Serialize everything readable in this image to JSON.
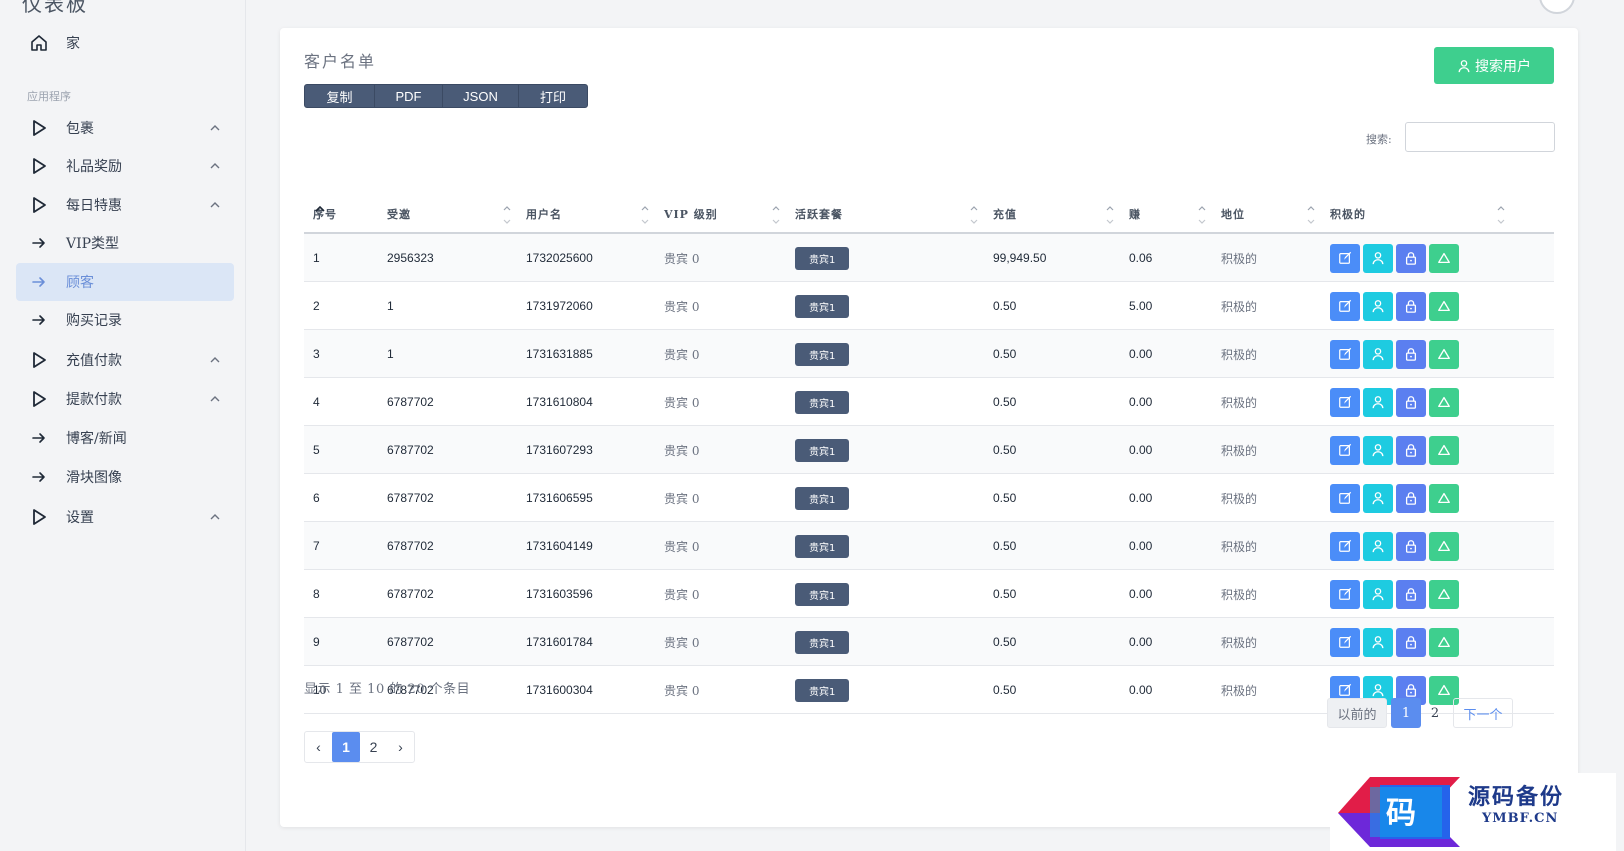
{
  "sidebar": {
    "title": "仪表板",
    "section_label": "应用程序",
    "items": [
      {
        "label": "家",
        "icon": "home-icon",
        "expandable": false,
        "active": false
      },
      {
        "label": "包裹",
        "icon": "play-icon",
        "expandable": true,
        "active": false
      },
      {
        "label": "礼品奖励",
        "icon": "play-icon",
        "expandable": true,
        "active": false
      },
      {
        "label": "每日特惠",
        "icon": "play-icon",
        "expandable": true,
        "active": false
      },
      {
        "label": "VIP类型",
        "icon": "arrow-right-icon",
        "expandable": false,
        "active": false
      },
      {
        "label": "顾客",
        "icon": "arrow-right-icon",
        "expandable": false,
        "active": true
      },
      {
        "label": "购买记录",
        "icon": "arrow-right-icon",
        "expandable": false,
        "active": false
      },
      {
        "label": "充值付款",
        "icon": "play-icon",
        "expandable": true,
        "active": false
      },
      {
        "label": "提款付款",
        "icon": "play-icon",
        "expandable": true,
        "active": false
      },
      {
        "label": "博客/新闻",
        "icon": "arrow-right-icon",
        "expandable": false,
        "active": false
      },
      {
        "label": "滑块图像",
        "icon": "arrow-right-icon",
        "expandable": false,
        "active": false
      },
      {
        "label": "设置",
        "icon": "play-icon",
        "expandable": true,
        "active": false
      }
    ]
  },
  "card": {
    "title": "客户名单",
    "search_user_button": "搜索用户",
    "export_buttons": [
      "复制",
      "PDF",
      "JSON",
      "打印"
    ],
    "search_label": "搜索:",
    "search_value": ""
  },
  "table": {
    "columns": [
      "序号",
      "受邀",
      "用户名",
      "VIP 级别",
      "活跃套餐",
      "充值",
      "赚",
      "地位",
      "积极的"
    ],
    "rows": [
      [
        "1",
        "2956323",
        "1732025600",
        "贵宾 0",
        "贵宾1",
        "99,949.50",
        "0.06",
        "积极的"
      ],
      [
        "2",
        "1",
        "1731972060",
        "贵宾 0",
        "贵宾1",
        "0.50",
        "5.00",
        "积极的"
      ],
      [
        "3",
        "1",
        "1731631885",
        "贵宾 0",
        "贵宾1",
        "0.50",
        "0.00",
        "积极的"
      ],
      [
        "4",
        "6787702",
        "1731610804",
        "贵宾 0",
        "贵宾1",
        "0.50",
        "0.00",
        "积极的"
      ],
      [
        "5",
        "6787702",
        "1731607293",
        "贵宾 0",
        "贵宾1",
        "0.50",
        "0.00",
        "积极的"
      ],
      [
        "6",
        "6787702",
        "1731606595",
        "贵宾 0",
        "贵宾1",
        "0.50",
        "0.00",
        "积极的"
      ],
      [
        "7",
        "6787702",
        "1731604149",
        "贵宾 0",
        "贵宾1",
        "0.50",
        "0.00",
        "积极的"
      ],
      [
        "8",
        "6787702",
        "1731603596",
        "贵宾 0",
        "贵宾1",
        "0.50",
        "0.00",
        "积极的"
      ],
      [
        "9",
        "6787702",
        "1731601784",
        "贵宾 0",
        "贵宾1",
        "0.50",
        "0.00",
        "积极的"
      ],
      [
        "10",
        "6787702",
        "1731600304",
        "贵宾 0",
        "贵宾1",
        "0.50",
        "0.00",
        "积极的"
      ]
    ],
    "actions": [
      "edit-icon",
      "user-icon",
      "lock-icon",
      "triangle-icon"
    ]
  },
  "info": "显示 1 至 10 的 20 个条目",
  "pager_right": {
    "prev": "以前的",
    "pages": [
      "1",
      "2"
    ],
    "next": "下一个",
    "current": "1"
  },
  "pager_left": {
    "prev": "‹",
    "pages": [
      "1",
      "2"
    ],
    "next": "›",
    "current": "1"
  },
  "watermark": {
    "title": "源码备份",
    "sub": "YMBF.CN",
    "glyph": "码"
  },
  "colors": {
    "accent": "#5b8def",
    "green": "#3ecf8e",
    "cyan": "#1ecbe1",
    "slate": "#4a5b77"
  }
}
